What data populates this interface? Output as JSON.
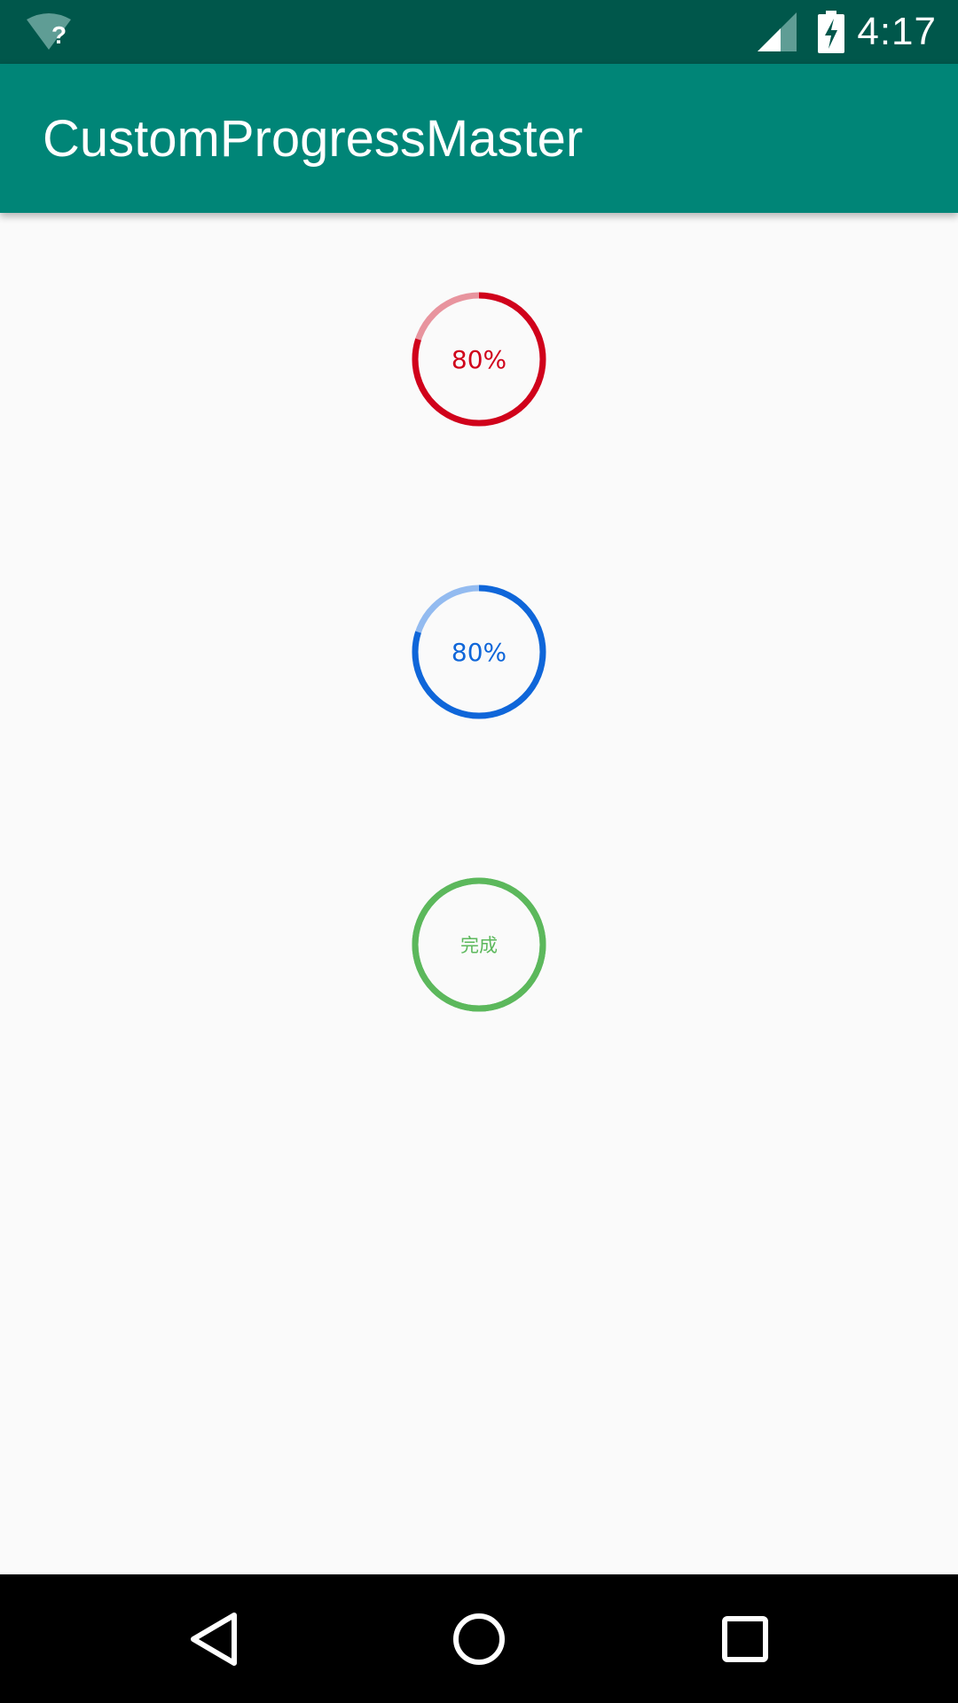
{
  "status_bar": {
    "time": "4:17",
    "wifi_badge": "?",
    "icons": [
      "wifi-unknown-icon",
      "signal-icon",
      "battery-charging-icon"
    ]
  },
  "app_bar": {
    "title": "CustomProgressMaster"
  },
  "progress_rings": [
    {
      "label": "80%",
      "progress": 0.8,
      "color": "#d0021b",
      "track_color": "#e8949e"
    },
    {
      "label": "80%",
      "progress": 0.8,
      "color": "#0f66d9",
      "track_color": "#93bbf0"
    },
    {
      "label": "完成",
      "progress": 1.0,
      "color": "#5cb85c",
      "track_color": "#5cb85c"
    }
  ],
  "nav_bar": {
    "icons": [
      "back-icon",
      "home-icon",
      "recents-icon"
    ]
  }
}
